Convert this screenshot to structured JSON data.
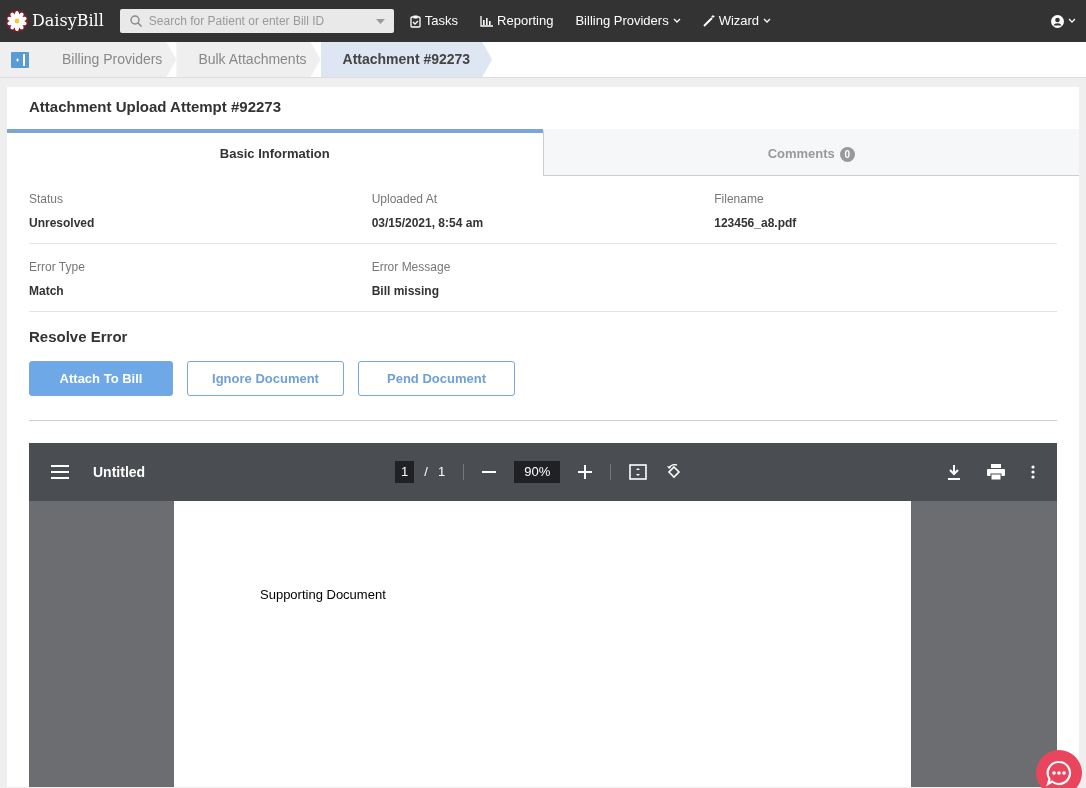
{
  "navbar": {
    "brand": "DaisyBill",
    "search": {
      "placeholder": "Search for Patient or enter Bill ID"
    },
    "items": [
      {
        "label": "Tasks",
        "dropdown": false
      },
      {
        "label": "Reporting",
        "dropdown": false
      },
      {
        "label": "Billing Providers",
        "dropdown": true
      },
      {
        "label": "Wizard",
        "dropdown": true
      }
    ]
  },
  "breadcrumbs": [
    {
      "label": "Billing Providers",
      "selected": false
    },
    {
      "label": "Bulk Attachments",
      "selected": false
    },
    {
      "label": "Attachment #92273",
      "selected": true
    }
  ],
  "card": {
    "title": "Attachment Upload Attempt #92273",
    "tabs": [
      {
        "label": "Basic Information",
        "selected": true
      },
      {
        "label": "Comments",
        "selected": false,
        "count": "0"
      }
    ],
    "field_rows": [
      [
        {
          "label": "Status",
          "value": "Unresolved"
        },
        {
          "label": "Uploaded At",
          "value": "03/15/2021, 8:54 am"
        },
        {
          "label": "Filename",
          "value": "123456_a8.pdf"
        }
      ],
      [
        {
          "label": "Error Type",
          "value": "Match"
        },
        {
          "label": "Error Message",
          "value": "Bill missing"
        }
      ]
    ],
    "resolve_heading": "Resolve Error",
    "buttons": [
      {
        "label": "Attach To Bill",
        "kind": "primary"
      },
      {
        "label": "Ignore Document",
        "kind": "outline"
      },
      {
        "label": "Pend Document",
        "kind": "outline"
      }
    ]
  },
  "pdf_viewer": {
    "title": "Untitled",
    "page": "1",
    "separator": "/",
    "total_pages": "1",
    "zoom": "90%",
    "document_text": "Supporting Document"
  }
}
